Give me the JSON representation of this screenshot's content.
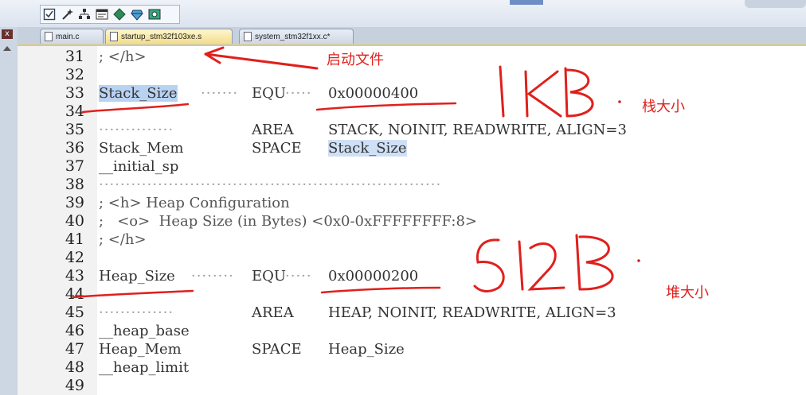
{
  "editor": {
    "tabs": [
      {
        "label": "main.c",
        "active": false
      },
      {
        "label": "startup_stm32f103xe.s",
        "active": true
      },
      {
        "label": "system_stm32f1xx.c*",
        "active": false
      }
    ],
    "lines": [
      {
        "num": "31",
        "text": "; </h>"
      },
      {
        "num": "32",
        "text": ""
      },
      {
        "num": "33",
        "label": "Stack_Size",
        "op": "EQU",
        "value": "0x00000400"
      },
      {
        "num": "34",
        "text": ""
      },
      {
        "num": "35",
        "op": "AREA",
        "value": "STACK, NOINIT, READWRITE, ALIGN=3"
      },
      {
        "num": "36",
        "label": "Stack_Mem",
        "op": "SPACE",
        "value": "Stack_Size"
      },
      {
        "num": "37",
        "label": "__initial_sp"
      },
      {
        "num": "38",
        "text": ""
      },
      {
        "num": "39",
        "text": "; <h> Heap Configuration"
      },
      {
        "num": "40",
        "text": ";   <o>  Heap Size (in Bytes) <0x0-0xFFFFFFFF:8>"
      },
      {
        "num": "41",
        "text": "; </h>"
      },
      {
        "num": "42",
        "text": ""
      },
      {
        "num": "43",
        "label": "Heap_Size",
        "op": "EQU",
        "value": "0x00000200"
      },
      {
        "num": "44",
        "text": ""
      },
      {
        "num": "45",
        "op": "AREA",
        "value": "HEAP, NOINIT, READWRITE, ALIGN=3"
      },
      {
        "num": "46",
        "label": "__heap_base"
      },
      {
        "num": "47",
        "label": "Heap_Mem",
        "op": "SPACE",
        "value": "Heap_Size"
      },
      {
        "num": "48",
        "label": "__heap_limit"
      },
      {
        "num": "49",
        "text": ""
      }
    ]
  },
  "annotations": {
    "startup_file": "启动文件",
    "stack_size_text": "栈大小",
    "heap_size_text": "堆大小",
    "stack_handwritten": "1KB",
    "heap_handwritten": "512B",
    "ink_color": "#e0201c"
  },
  "toolbar": {
    "icons": [
      "checkbox-icon",
      "wand-icon",
      "tree-icon",
      "window-icon",
      "diamond-icon",
      "gem-icon",
      "settings-icon"
    ]
  }
}
